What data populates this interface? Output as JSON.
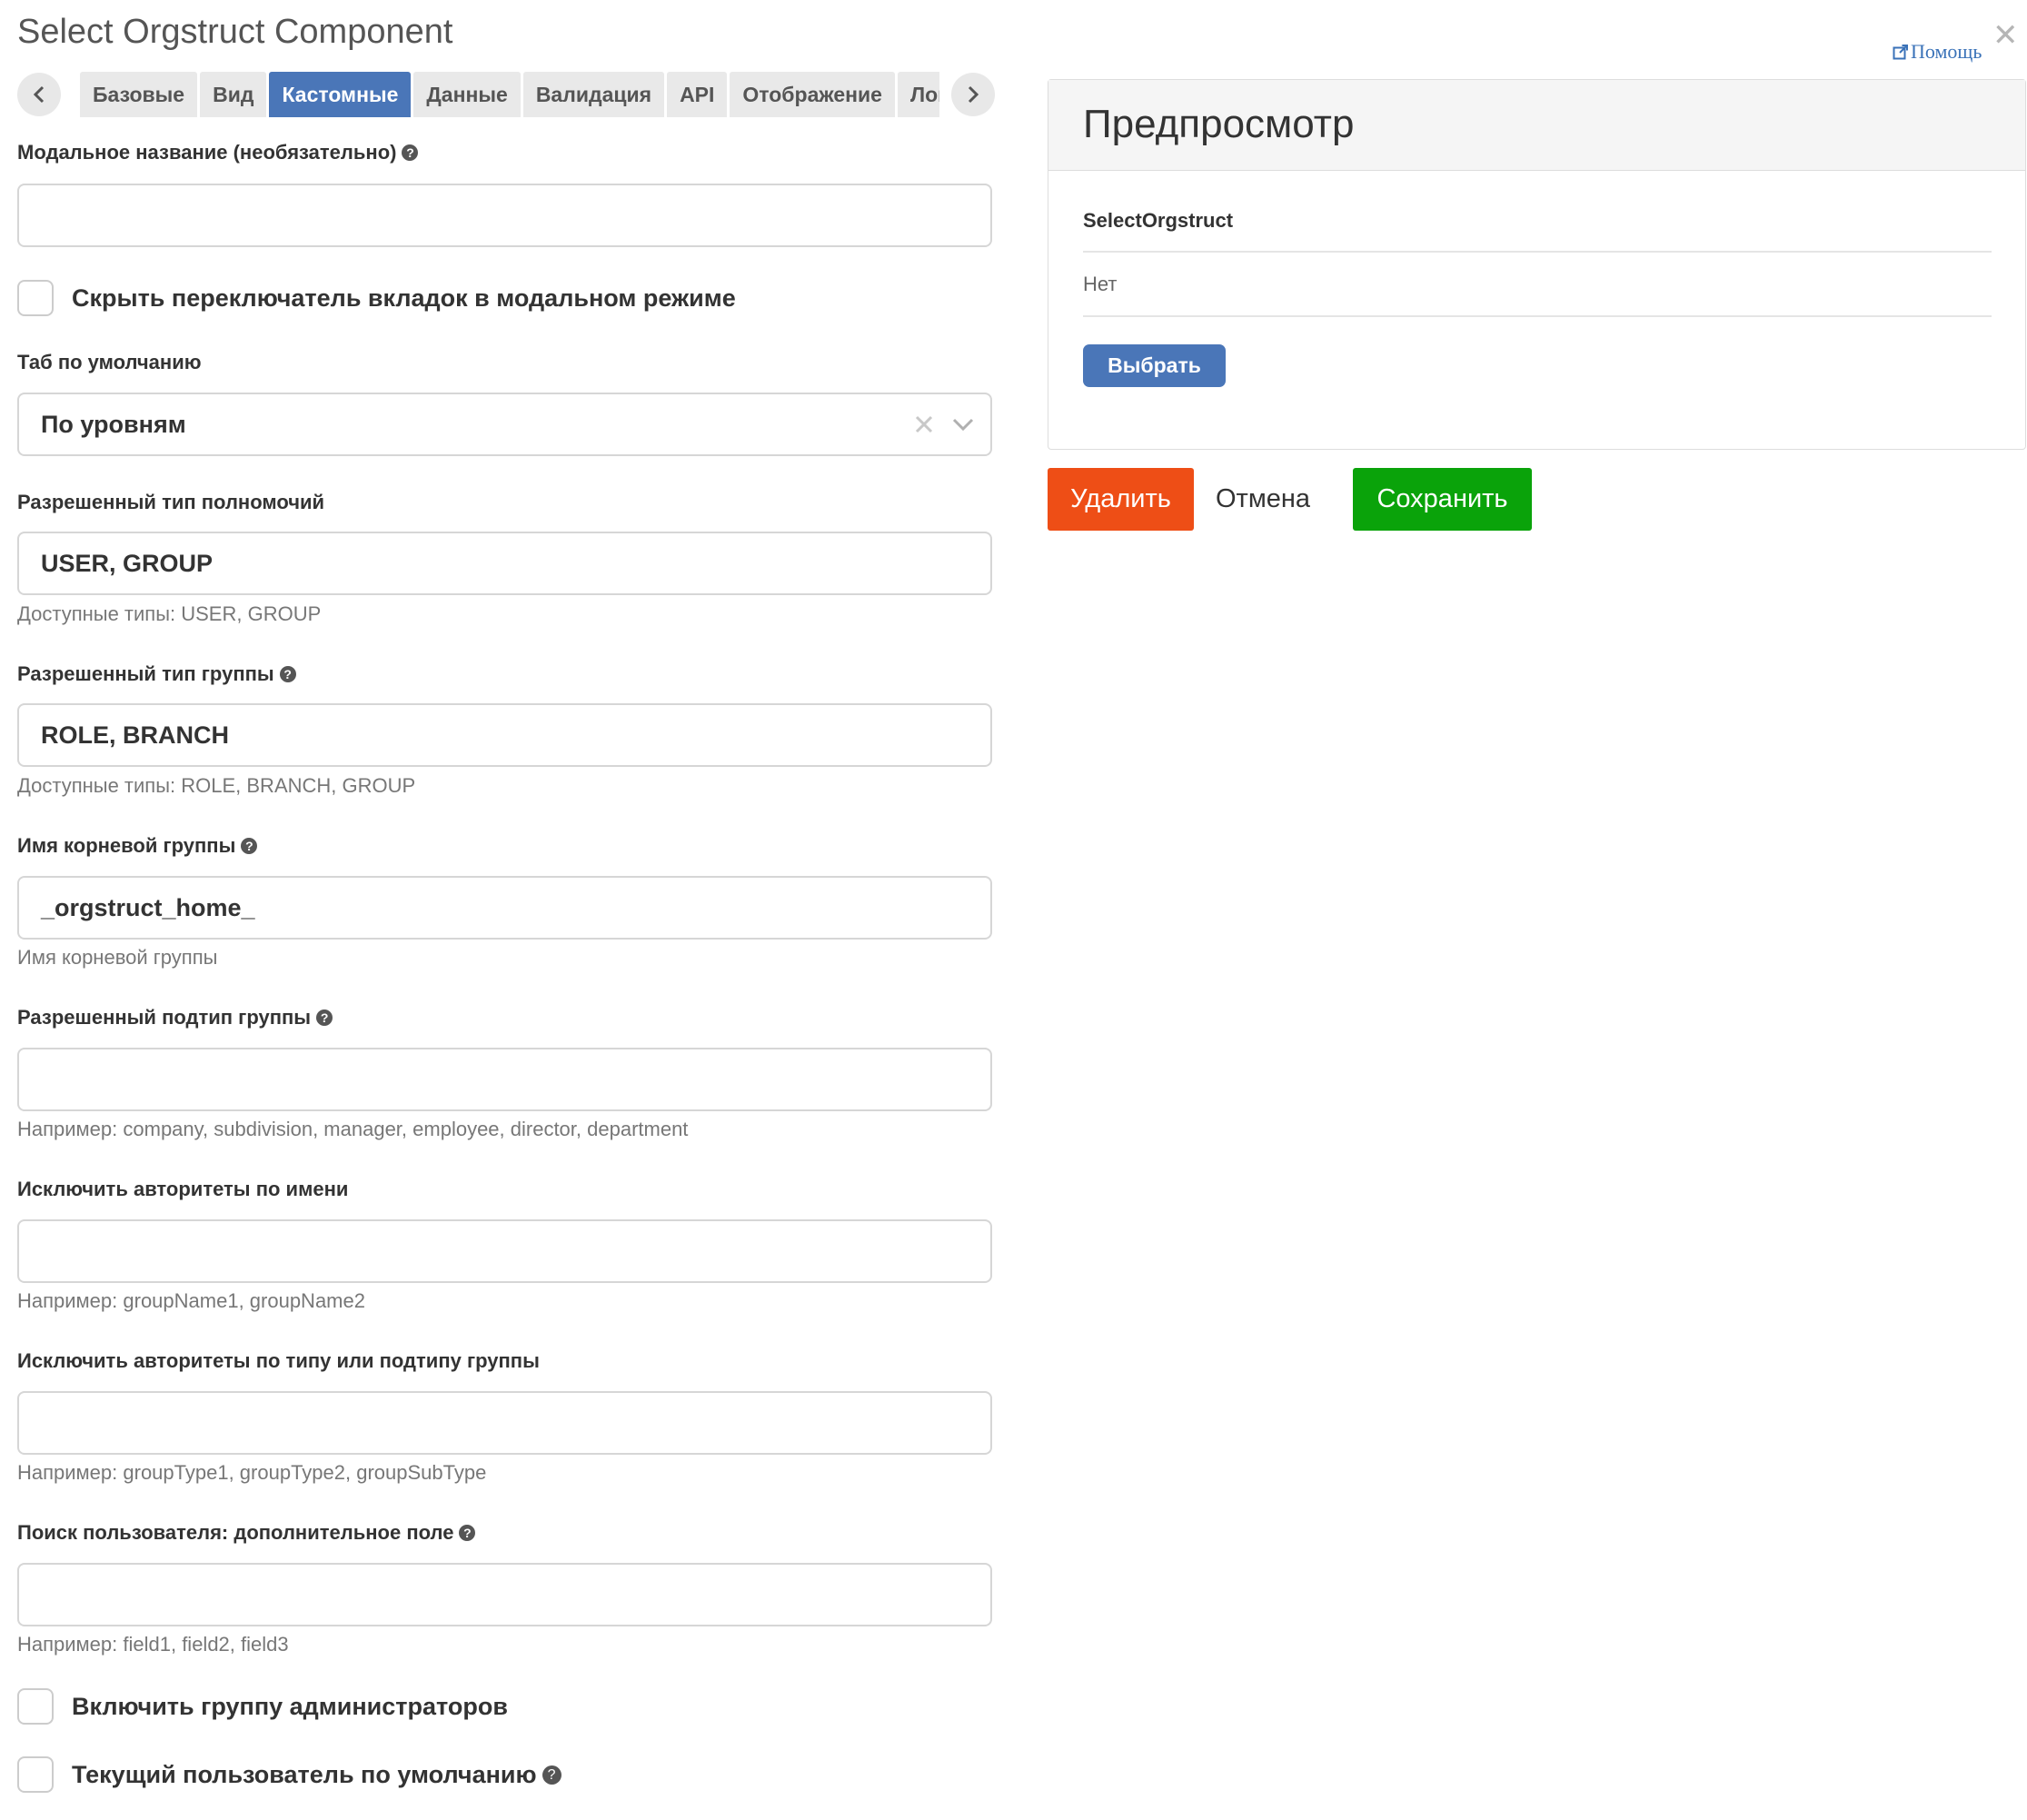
{
  "dialog": {
    "title": "Select Orgstruct Component",
    "help_label": "Помощь",
    "close_glyph": "✕"
  },
  "tabs": [
    {
      "label": "Базовые",
      "active": false
    },
    {
      "label": "Вид",
      "active": false
    },
    {
      "label": "Кастомные",
      "active": true
    },
    {
      "label": "Данные",
      "active": false
    },
    {
      "label": "Валидация",
      "active": false
    },
    {
      "label": "API",
      "active": false
    },
    {
      "label": "Отображение",
      "active": false
    },
    {
      "label": "Логика",
      "active": false
    }
  ],
  "form": {
    "modal_title": {
      "label": "Модальное название (необязательно)",
      "value": ""
    },
    "hide_tab_switcher": {
      "label": "Скрыть переключатель вкладок в модальном режиме",
      "checked": false
    },
    "default_tab": {
      "label": "Таб по умолчанию",
      "value": "По уровням"
    },
    "allowed_authority_type": {
      "label": "Разрешенный тип полномочий",
      "value": "USER, GROUP",
      "hint": "Доступные типы: USER, GROUP"
    },
    "allowed_group_type": {
      "label": "Разрешенный тип группы",
      "value": "ROLE, BRANCH",
      "hint": "Доступные типы: ROLE, BRANCH, GROUP"
    },
    "root_group_name": {
      "label": "Имя корневой группы",
      "value": "_orgstruct_home_",
      "hint": "Имя корневой группы"
    },
    "allowed_group_subtype": {
      "label": "Разрешенный подтип группы",
      "value": "",
      "hint": "Например: company, subdivision, manager, employee, director, department"
    },
    "exclude_by_name": {
      "label": "Исключить авторитеты по имени",
      "value": "",
      "hint": "Например: groupName1, groupName2"
    },
    "exclude_by_type": {
      "label": "Исключить авторитеты по типу или подтипу группы",
      "value": "",
      "hint": "Например: groupType1, groupType2, groupSubType"
    },
    "user_search_field": {
      "label": "Поиск пользователя: дополнительное поле",
      "value": "",
      "hint": "Например: field1, field2, field3"
    },
    "include_admin_group": {
      "label": "Включить группу администраторов",
      "checked": false
    },
    "current_user_default": {
      "label": "Текущий пользователь по умолчанию",
      "checked": false
    }
  },
  "preview": {
    "title": "Предпросмотр",
    "component_label": "SelectOrgstruct",
    "value": "Нет",
    "select_button": "Выбрать"
  },
  "actions": {
    "delete": "Удалить",
    "cancel": "Отмена",
    "save": "Сохранить"
  },
  "colors": {
    "accent": "#4a76b8",
    "delete": "#ee4e16",
    "save": "#0aa30a"
  }
}
